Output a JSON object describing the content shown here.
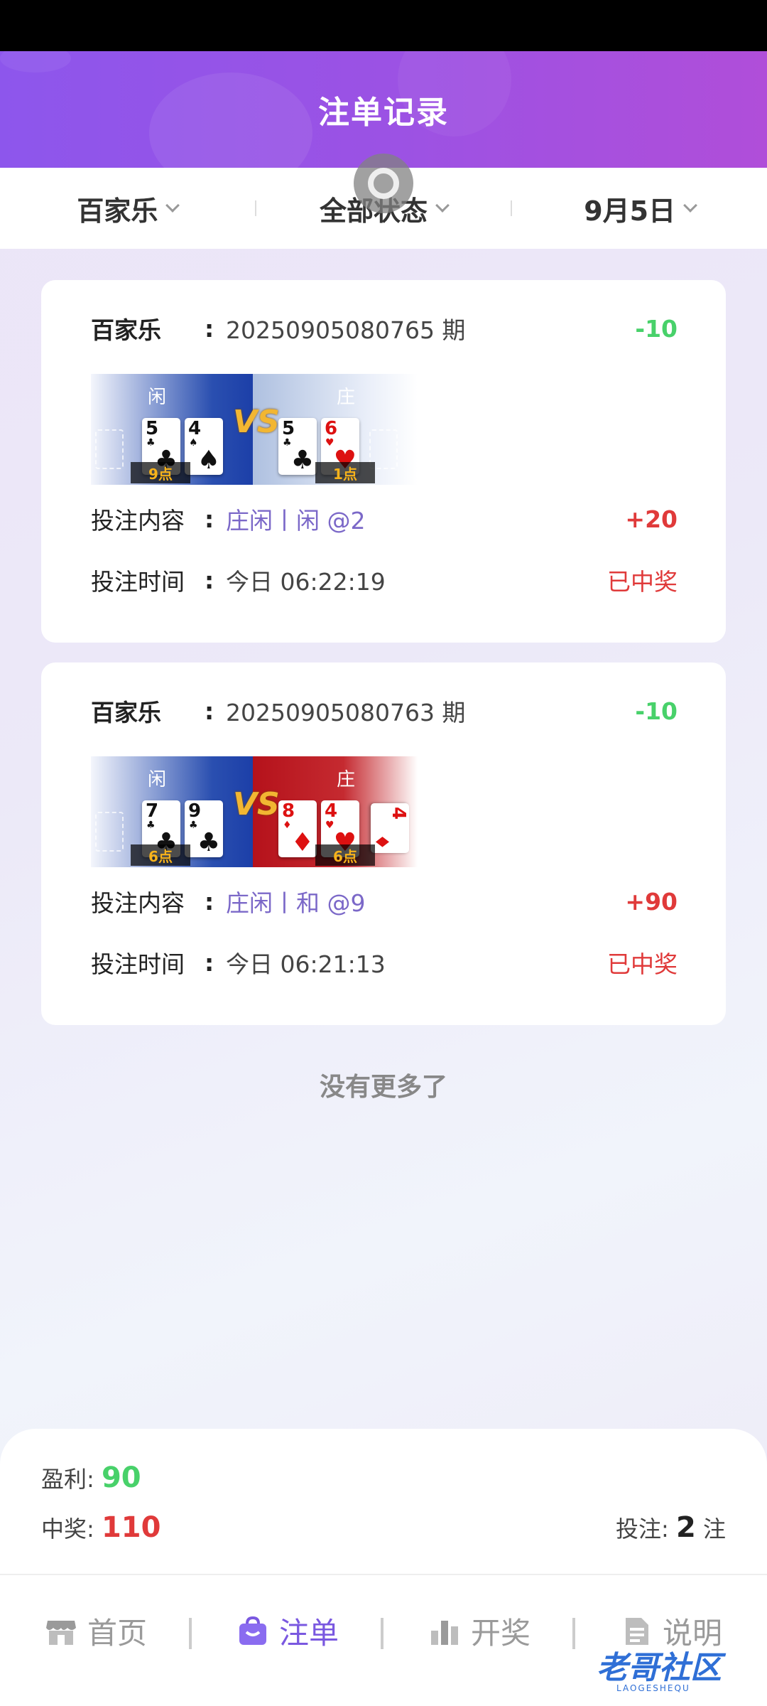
{
  "header": {
    "title": "注单记录"
  },
  "filters": [
    {
      "label": "百家乐"
    },
    {
      "label": "全部状态"
    },
    {
      "label": "9月5日"
    }
  ],
  "records": [
    {
      "game": "百家乐",
      "issue": "20250905080765 期",
      "stake": "-10",
      "player_label": "闲",
      "banker_label": "庄",
      "player_cards": [
        {
          "rank": "5",
          "suit": "♣"
        },
        {
          "rank": "4",
          "suit": "♠"
        }
      ],
      "banker_cards": [
        {
          "rank": "5",
          "suit": "♣"
        },
        {
          "rank": "6",
          "suit": "♥"
        }
      ],
      "player_points": "9点",
      "banker_points": "1点",
      "vs": "VS",
      "content_label": "投注内容",
      "content_value": "庄闲丨闲 @2",
      "payout": "+20",
      "time_label": "投注时间",
      "time_value": "今日 06:22:19",
      "status": "已中奖"
    },
    {
      "game": "百家乐",
      "issue": "20250905080763 期",
      "stake": "-10",
      "player_label": "闲",
      "banker_label": "庄",
      "player_cards": [
        {
          "rank": "7",
          "suit": "♣"
        },
        {
          "rank": "9",
          "suit": "♣"
        }
      ],
      "banker_cards": [
        {
          "rank": "8",
          "suit": "♦"
        },
        {
          "rank": "4",
          "suit": "♥"
        },
        {
          "rank": "4",
          "suit": "♦"
        }
      ],
      "player_points": "6点",
      "banker_points": "6点",
      "vs": "VS",
      "content_label": "投注内容",
      "content_value": "庄闲丨和 @9",
      "payout": "+90",
      "time_label": "投注时间",
      "time_value": "今日 06:21:13",
      "status": "已中奖"
    }
  ],
  "no_more": "没有更多了",
  "summary": {
    "profit_label": "盈利:",
    "profit_value": "90",
    "win_label": "中奖:",
    "win_value": "110",
    "bets_label": "投注:",
    "bets_value": "2",
    "bets_unit": "注"
  },
  "tabs": [
    {
      "label": "首页",
      "icon": "shop-icon"
    },
    {
      "label": "注单",
      "icon": "bag-icon"
    },
    {
      "label": "开奖",
      "icon": "bar-chart-icon"
    },
    {
      "label": "说明",
      "icon": "document-icon"
    }
  ],
  "watermark": {
    "text": "老哥社区",
    "sub": "LAOGESHEQU"
  },
  "colors": {
    "accent": "#7a58e0",
    "loss": "#48d16a",
    "win": "#e03a3a",
    "header_start": "#8d56ec",
    "header_end": "#b04ed9"
  }
}
